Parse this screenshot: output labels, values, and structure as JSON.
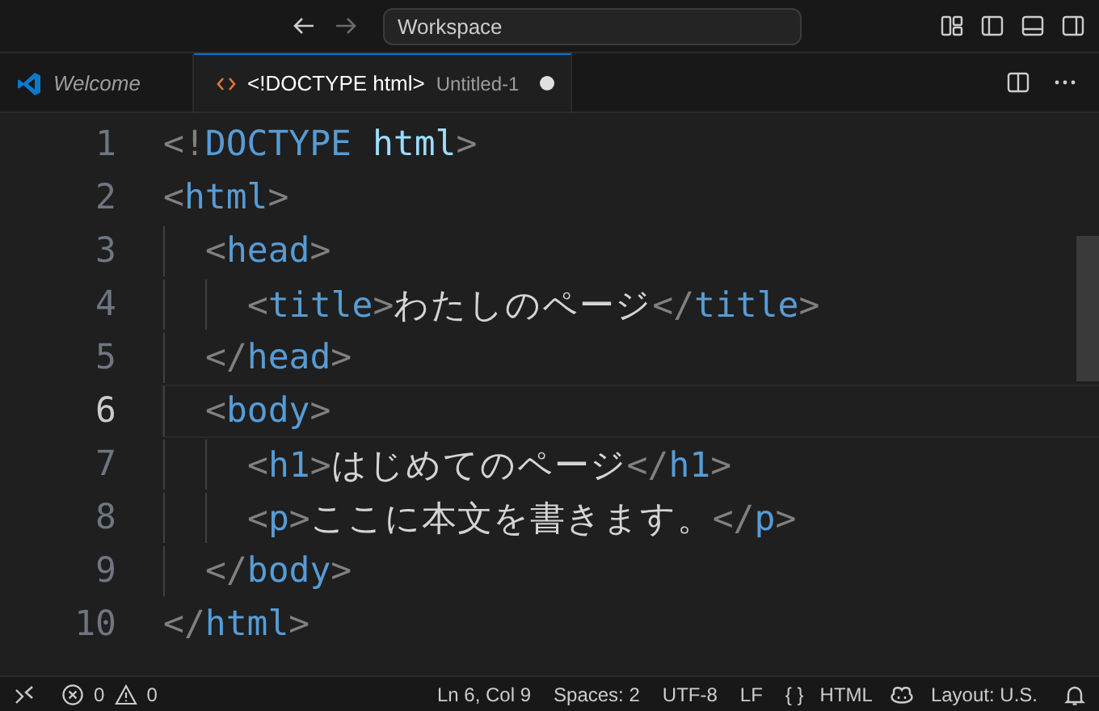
{
  "title_bar": {
    "search": {
      "value": "Workspace"
    }
  },
  "tabs": [
    {
      "label": "Welcome",
      "kind": "welcome",
      "selected": false,
      "dirty": false
    },
    {
      "label": "<!DOCTYPE html>",
      "description": "Untitled-1",
      "kind": "html",
      "selected": true,
      "dirty": true
    }
  ],
  "editor": {
    "lines": [
      {
        "number": "1",
        "current": false,
        "tokens": [
          {
            "kind": "punct",
            "text": "<!"
          },
          {
            "kind": "tag",
            "text": "DOCTYPE"
          },
          {
            "kind": "attr",
            "text": " html"
          },
          {
            "kind": "punct",
            "text": ">"
          }
        ]
      },
      {
        "number": "2",
        "current": false,
        "tokens": [
          {
            "kind": "punct",
            "text": "<"
          },
          {
            "kind": "tag",
            "text": "html"
          },
          {
            "kind": "punct",
            "text": ">"
          }
        ],
        "children": [
          {
            "number": "3",
            "current": false,
            "tokens": [
              {
                "kind": "punct",
                "text": "<"
              },
              {
                "kind": "tag",
                "text": "head"
              },
              {
                "kind": "punct",
                "text": ">"
              }
            ],
            "children": [
              {
                "number": "4",
                "current": false,
                "tokens": [
                  {
                    "kind": "punct",
                    "text": "<"
                  },
                  {
                    "kind": "tag",
                    "text": "title"
                  },
                  {
                    "kind": "punct",
                    "text": ">"
                  },
                  {
                    "kind": "text",
                    "text": "わたしのページ"
                  },
                  {
                    "kind": "punct",
                    "text": "</"
                  },
                  {
                    "kind": "tag",
                    "text": "title"
                  },
                  {
                    "kind": "punct",
                    "text": ">"
                  }
                ]
              }
            ]
          },
          {
            "number": "5",
            "current": false,
            "tokens": [
              {
                "kind": "punct",
                "text": "</"
              },
              {
                "kind": "tag",
                "text": "head"
              },
              {
                "kind": "punct",
                "text": ">"
              }
            ]
          },
          {
            "number": "6",
            "current": true,
            "tokens": [
              {
                "kind": "punct",
                "text": "<"
              },
              {
                "kind": "tag",
                "text": "body"
              },
              {
                "kind": "punct",
                "text": ">"
              }
            ],
            "children": [
              {
                "number": "7",
                "current": false,
                "tokens": [
                  {
                    "kind": "punct",
                    "text": "<"
                  },
                  {
                    "kind": "tag",
                    "text": "h1"
                  },
                  {
                    "kind": "punct",
                    "text": ">"
                  },
                  {
                    "kind": "text",
                    "text": "はじめてのページ"
                  },
                  {
                    "kind": "punct",
                    "text": "</"
                  },
                  {
                    "kind": "tag",
                    "text": "h1"
                  },
                  {
                    "kind": "punct",
                    "text": ">"
                  }
                ]
              },
              {
                "number": "8",
                "current": false,
                "tokens": [
                  {
                    "kind": "punct",
                    "text": "<"
                  },
                  {
                    "kind": "tag",
                    "text": "p"
                  },
                  {
                    "kind": "punct",
                    "text": ">"
                  },
                  {
                    "kind": "text",
                    "text": "ここに本文を書きます。"
                  },
                  {
                    "kind": "punct",
                    "text": "</"
                  },
                  {
                    "kind": "tag",
                    "text": "p"
                  },
                  {
                    "kind": "punct",
                    "text": ">"
                  }
                ]
              }
            ]
          },
          {
            "number": "9",
            "current": false,
            "tokens": [
              {
                "kind": "punct",
                "text": "</"
              },
              {
                "kind": "tag",
                "text": "body"
              },
              {
                "kind": "punct",
                "text": ">"
              }
            ]
          }
        ]
      },
      {
        "number": "10",
        "current": false,
        "tokens": [
          {
            "kind": "punct",
            "text": "</"
          },
          {
            "kind": "tag",
            "text": "html"
          },
          {
            "kind": "punct",
            "text": ">"
          }
        ]
      }
    ]
  },
  "status_bar": {
    "errors": "0",
    "warnings": "0",
    "items": [
      "Ln 6, Col 9",
      "Spaces: 2",
      "UTF-8",
      "LF"
    ],
    "language": {
      "icon": "{ }",
      "label": "HTML"
    },
    "layout": "Layout: U.S."
  }
}
